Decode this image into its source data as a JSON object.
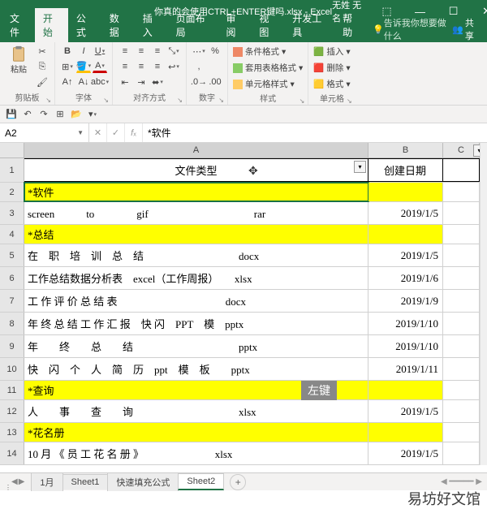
{
  "titlebar": {
    "filename": "你真的会使用CTRL+ENTER键吗.xlsx - Excel",
    "username": "无姓 无名"
  },
  "tabs": {
    "file": "文件",
    "home": "开始",
    "formulas": "公式",
    "data": "数据",
    "insert": "插入",
    "pageLayout": "页面布局",
    "review": "审阅",
    "view": "视图",
    "developer": "开发工具",
    "help": "帮助",
    "tellMe": "告诉我你想要做什么",
    "share": "共享"
  },
  "ribbon": {
    "paste": "粘贴",
    "grpClipboard": "剪贴板",
    "grpFont": "字体",
    "grpAlign": "对齐方式",
    "grpNumber": "数字",
    "grpStyles": "样式",
    "grpCells": "单元格",
    "condFmt": "条件格式",
    "tableFmt": "套用表格格式",
    "cellStyle": "单元格样式",
    "insert": "插入",
    "delete": "删除",
    "format": "格式",
    "numPct": "%"
  },
  "qat": {
    "sep": "·"
  },
  "namebox": {
    "ref": "A2"
  },
  "formulabar": {
    "value": "*软件"
  },
  "columns": {
    "A": "A",
    "B": "B",
    "C": "C"
  },
  "headers": {
    "A": "文件类型",
    "B": "创建日期"
  },
  "rows": [
    {
      "n": 1,
      "type": "header"
    },
    {
      "n": 2,
      "a": "*软件",
      "yellow": true,
      "selected": true
    },
    {
      "n": 3,
      "a": "screen　　　to　　　　gif　　　　　　　　　　rar",
      "b": "2019/1/5"
    },
    {
      "n": 4,
      "a": "*总结",
      "yellow": true
    },
    {
      "n": 5,
      "a": "在　职　培　训　总　结　　　　　　　　　docx",
      "b": "2019/1/5"
    },
    {
      "n": 6,
      "a": "工作总结数据分析表　excel（工作周报）　　xlsx",
      "b": "2019/1/6"
    },
    {
      "n": 7,
      "a": "工 作 评 价 总 结 表　　　　　　　　　　 docx",
      "b": "2019/1/9"
    },
    {
      "n": 8,
      "a": "年 终 总 结 工 作 汇 报　快 闪　PPT　模　pptx",
      "b": "2019/1/10"
    },
    {
      "n": 9,
      "a": "年　　终　　总　　结　　　　　　　　　　pptx",
      "b": "2019/1/10"
    },
    {
      "n": 10,
      "a": "快　闪　个　人　简　历　ppt　模　板　　pptx",
      "b": "2019/1/11"
    },
    {
      "n": 11,
      "a": "*查询",
      "yellow": true
    },
    {
      "n": 12,
      "a": "人　　事　　查　　询　　　　　　　　　　xlsx",
      "b": "2019/1/5"
    },
    {
      "n": 13,
      "a": "*花名册",
      "yellow": true
    },
    {
      "n": 14,
      "a": "10 月 《 员 工 花 名 册 》　　　　　　　 xlsx",
      "b": "2019/1/5"
    }
  ],
  "sheetTabs": {
    "t1": "1月",
    "t2": "Sheet1",
    "t3": "快速填充公式",
    "t4": "Sheet2"
  },
  "hint": "左键",
  "watermark": "易坊好文馆"
}
